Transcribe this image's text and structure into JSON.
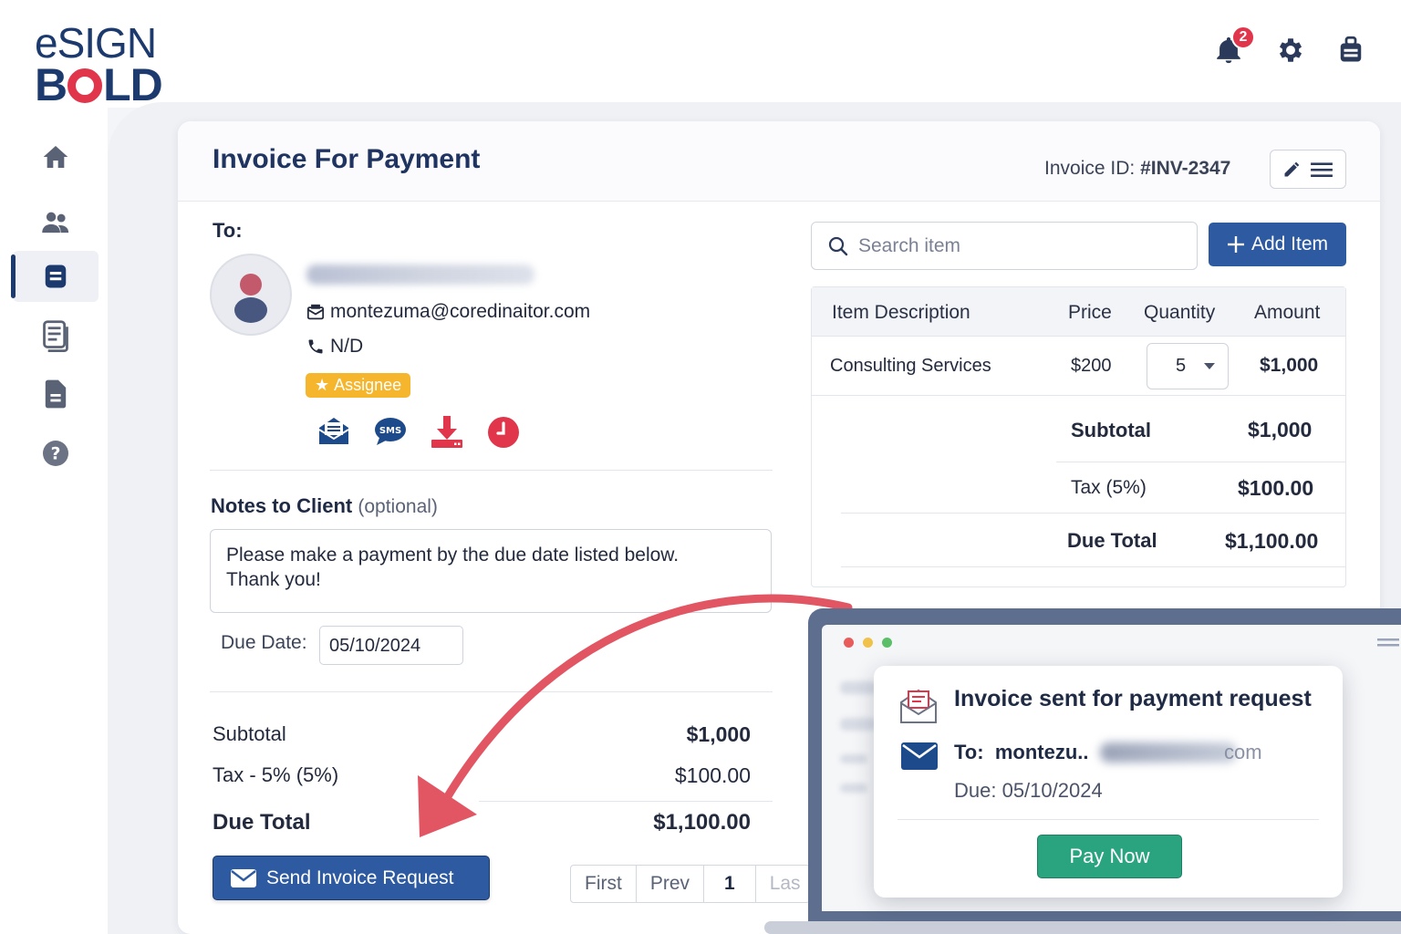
{
  "brand": {
    "line1": "eSIGN",
    "line2_a": "B",
    "line2_b": "LD"
  },
  "notifications": {
    "count": "2"
  },
  "header": {
    "title": "Invoice For Payment",
    "invoice_id_label": "Invoice ID:",
    "invoice_id": "#INV-2347"
  },
  "client": {
    "to_label": "To:",
    "email": "montezuma@coredinaitor.com",
    "phone": "N/D",
    "role_badge": "Assignee"
  },
  "notes": {
    "label": "Notes to Client",
    "optional": "(optional)",
    "text": "Please make a payment by the due date listed below.\nThank you!"
  },
  "due_date": {
    "label": "Due Date:",
    "value": "05/10/2024"
  },
  "summary_left": {
    "subtotal_label": "Subtotal",
    "subtotal": "$1,000",
    "tax_label": "Tax - 5% (5%)",
    "tax": "$100.00",
    "total_label": "Due Total",
    "total": "$1,100.00"
  },
  "send_button": "Send Invoice Request",
  "pager": {
    "first": "First",
    "prev": "Prev",
    "current": "1",
    "last": "Las"
  },
  "search": {
    "placeholder": "Search item"
  },
  "add_button": "Add Item",
  "items_table": {
    "headers": [
      "Item Description",
      "Price",
      "Quantity",
      "Amount"
    ],
    "rows": [
      {
        "description": "Consulting Services",
        "price": "$200",
        "quantity": "5",
        "amount": "$1,000"
      }
    ]
  },
  "totals_right": {
    "subtotal_label": "Subtotal",
    "subtotal": "$1,000",
    "tax_label": "Tax (5%)",
    "tax": "$100.00",
    "total_label": "Due Total",
    "total": "$1,100.00"
  },
  "popup": {
    "title": "Invoice sent for payment request",
    "to_label": "To:",
    "to_visible": "montezu..",
    "to_suffix": "com",
    "due": "Due: 05/10/2024",
    "pay_button": "Pay Now"
  },
  "colors": {
    "primary": "#2d5aa0",
    "accent": "#e0354a",
    "success": "#2aa37f",
    "badge": "#f5b52c"
  }
}
